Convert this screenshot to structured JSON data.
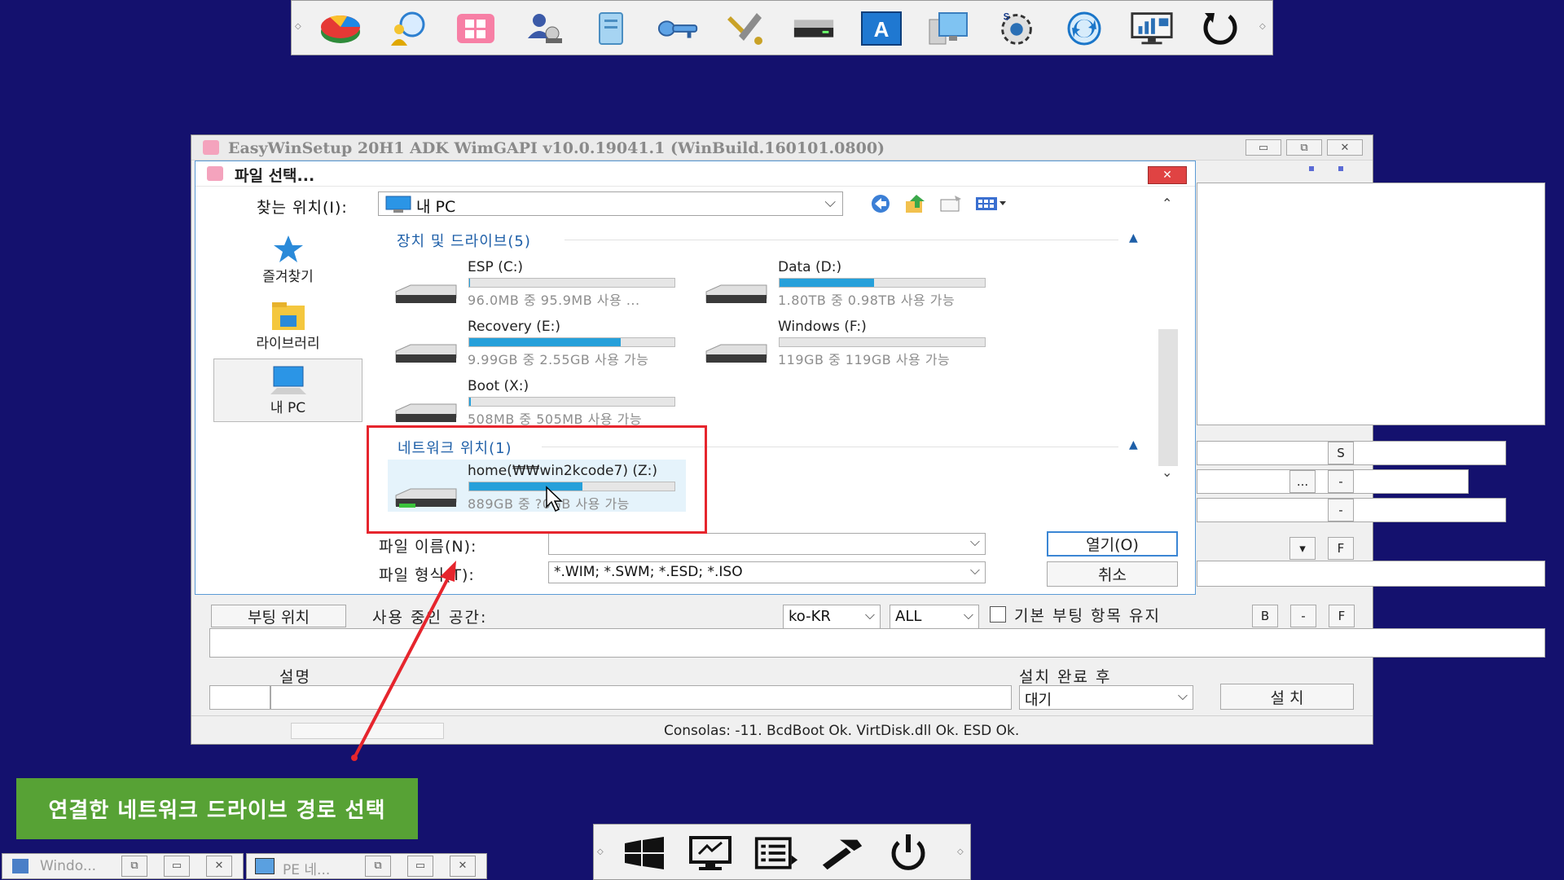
{
  "main_window": {
    "title": "EasyWinSetup   20H1 ADK   WimGAPI v10.0.19041.1 (WinBuild.160101.0800)",
    "right_panel": {
      "btn_s": "S",
      "btn_dots": "...",
      "btn_dash1": "-",
      "btn_dash2": "-",
      "btn_f1": "F"
    },
    "boot_location_button": "부팅 위치",
    "used_space_label": "사용 중인 공간:",
    "lang_select": "ko-KR",
    "edition_select": "ALL",
    "keep_boot_entry_label": "기본 부팅 항목 유지",
    "btn_b": "B",
    "btn_dash3": "-",
    "btn_f2": "F",
    "description_label": "설명",
    "after_install_label": "설치 완료 후",
    "after_install_select": "대기",
    "install_button": "설 치",
    "status_text": "Consolas: -11. BcdBoot Ok. VirtDisk.dll Ok. ESD Ok."
  },
  "file_dialog": {
    "title": "파일 선택...",
    "lookin_label": "찾는 위치(I):",
    "lookin_value": "내 PC",
    "places": [
      {
        "label": "즐겨찾기",
        "icon": "star-icon"
      },
      {
        "label": "라이브러리",
        "icon": "library-icon"
      },
      {
        "label": "내 PC",
        "icon": "computer-icon"
      }
    ],
    "groups": [
      {
        "title": "장치 및 드라이브(5)"
      },
      {
        "title": "네트워크 위치(1)"
      }
    ],
    "drives": [
      {
        "name": "ESP (C:)",
        "size": "96.0MB 중 95.9MB 사용 ...",
        "used": 0.001
      },
      {
        "name": "Data (D:)",
        "size": "1.80TB 중 0.98TB 사용 가능",
        "used": 0.46
      },
      {
        "name": "Recovery (E:)",
        "size": "9.99GB 중 2.55GB 사용 가능",
        "used": 0.74
      },
      {
        "name": "Windows (F:)",
        "size": "119GB 중 119GB 사용 가능",
        "used": 0.0
      },
      {
        "name": "Boot (X:)",
        "size": "508MB 중 505MB 사용 가능",
        "used": 0.006
      }
    ],
    "network_drive": {
      "name": "home(₩₩win2kcode7) (Z:)",
      "size": "889GB 중 ?0GB 사용 가능",
      "used": 0.55
    },
    "filename_label": "파일 이름(N):",
    "filename_value": "",
    "filetype_label": "파일 형식(T):",
    "filetype_value": "*.WIM; *.SWM; *.ESD; *.ISO",
    "open_button": "열기(O)",
    "cancel_button": "취소"
  },
  "annotation": {
    "label": "연결한 네트워크 드라이브 경로 선택",
    "color": "#e6252d",
    "label_bg": "#57a235"
  },
  "taskbar": {
    "items": [
      {
        "label": "Windo..."
      },
      {
        "label": "PE 네..."
      }
    ]
  },
  "top_toolbar_icons": [
    "partition-icon",
    "user-search-icon",
    "windows-app-icon",
    "network-user-icon",
    "document-icon",
    "key-icon",
    "tools-icon",
    "drive-icon",
    "font-a-icon",
    "computer-window-icon",
    "camera-settings-icon",
    "sync-icon",
    "monitor-chart-icon",
    "refresh-icon"
  ],
  "bottom_dock_icons": [
    "windows-logo-icon",
    "monitor-icon",
    "list-icon",
    "hammer-icon",
    "power-icon"
  ]
}
